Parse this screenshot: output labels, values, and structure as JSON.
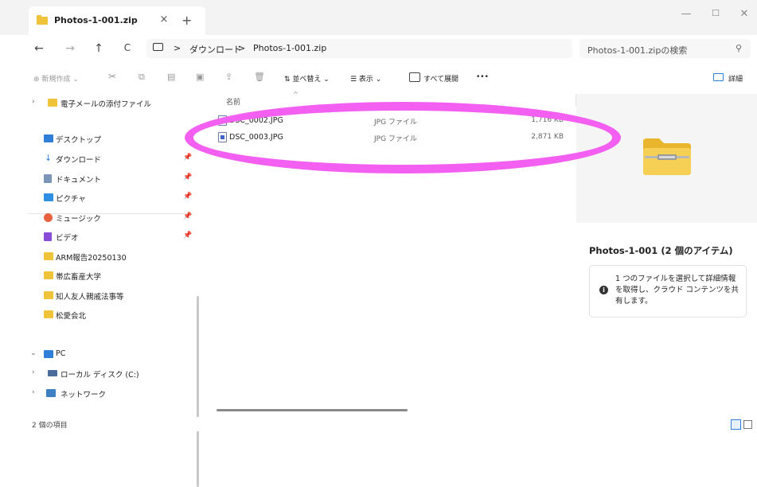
{
  "window": {
    "tab_title": "Photos-1-001.zip",
    "tab_close": "×",
    "new_tab": "+",
    "minimize": "—",
    "maximize": "☐",
    "close": "✕"
  },
  "nav": {
    "back": "←",
    "forward": "→",
    "up": "↑",
    "refresh": "C"
  },
  "address": {
    "separator": ">",
    "crumbs": [
      "ダウンロード",
      "Photos-1-001.zip"
    ]
  },
  "search": {
    "placeholder": "Photos-1-001.zipの検索",
    "icon": "search-icon"
  },
  "commands": {
    "new": "⊕ 新規作成 ⌄",
    "sort": "⇅ 並べ替え ⌄",
    "view": "☰ 表示 ⌄",
    "expand_all": "すべて展開",
    "more": "•••",
    "details": "詳細"
  },
  "sidebar": {
    "attachments": "電子メールの添付ファイル",
    "quick": [
      {
        "label": "デスクトップ",
        "icon": "desktop-icon",
        "color": "#2f7fd8"
      },
      {
        "label": "ダウンロード",
        "icon": "download-icon",
        "color": "#2f7fd8"
      },
      {
        "label": "ドキュメント",
        "icon": "documents-icon",
        "color": "#7a95b8"
      },
      {
        "label": "ピクチャ",
        "icon": "pictures-icon",
        "color": "#2f8fe0"
      },
      {
        "label": "ミュージック",
        "icon": "music-icon",
        "color": "#e8623f"
      },
      {
        "label": "ビデオ",
        "icon": "videos-icon",
        "color": "#8a4bd6"
      }
    ],
    "folders": [
      "ARM報告20250130",
      "帯広畜産大学",
      "知人友人親戚法事等",
      "松愛会北"
    ],
    "pc": "PC",
    "local_disk": "ローカル ディスク (C:)",
    "network": "ネットワーク"
  },
  "filelist": {
    "header_name": "名前",
    "files": [
      {
        "name": "DSC_0002.JPG",
        "type": "JPG ファイル",
        "size": "1,716 KB"
      },
      {
        "name": "DSC_0003.JPG",
        "type": "JPG ファイル",
        "size": "2,871 KB"
      }
    ]
  },
  "details": {
    "title": "Photos-1-001 (2 個のアイテム)",
    "info": "1 つのファイルを選択して詳細情報を取得し、クラウド コンテンツを共有します。"
  },
  "status": {
    "count": "2 個の項目"
  },
  "colors": {
    "highlight": "#f35ff0",
    "folder": "#f0c43a",
    "accent": "#2f7fd8"
  }
}
